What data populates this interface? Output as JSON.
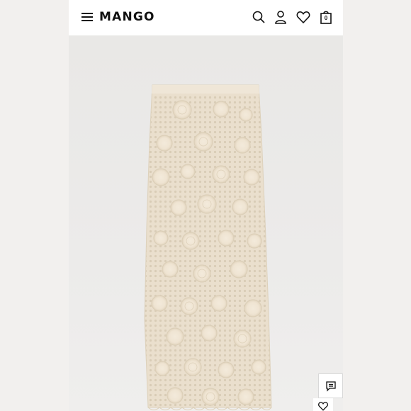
{
  "header": {
    "brand": "MANGO",
    "cart_count": "0"
  },
  "icons": {
    "menu": "hamburger-menu-icon",
    "search": "search-icon",
    "account": "user-icon",
    "wishlist": "heart-icon",
    "cart": "shopping-bag-icon",
    "chat": "chat-icon",
    "favorite": "heart-outline-icon"
  },
  "colors": {
    "header_bg": "#ffffff",
    "image_bg": "#ecebea",
    "lace": "#eadfcd",
    "lace_motif": "#f1e7d6",
    "text": "#111111"
  }
}
